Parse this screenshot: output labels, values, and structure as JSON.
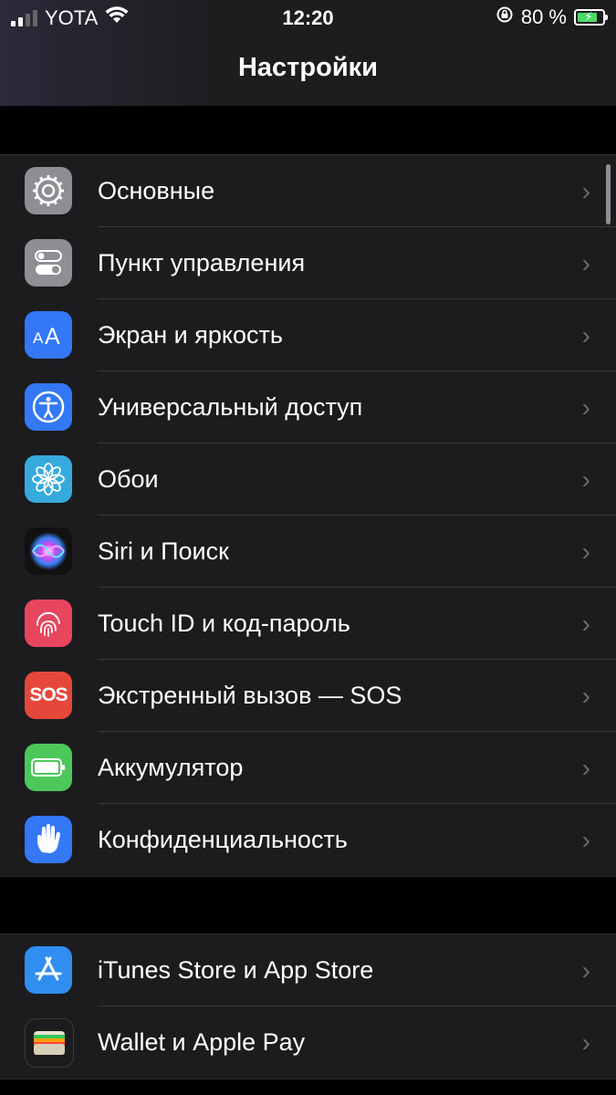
{
  "status_bar": {
    "carrier": "YOTA",
    "time": "12:20",
    "battery_percent": "80 %",
    "battery_level": 0.8
  },
  "nav": {
    "title": "Настройки"
  },
  "groups": [
    {
      "items": [
        {
          "label": "Основные",
          "icon": "gear-icon",
          "color": "#8e8e93"
        },
        {
          "label": "Пункт управления",
          "icon": "toggles-icon",
          "color": "#8e8e93"
        },
        {
          "label": "Экран и яркость",
          "icon": "text-size-icon",
          "color": "#3478f6"
        },
        {
          "label": "Универсальный доступ",
          "icon": "accessibility-icon",
          "color": "#3478f6"
        },
        {
          "label": "Обои",
          "icon": "flower-icon",
          "color": "#36aadc"
        },
        {
          "label": "Siri и Поиск",
          "icon": "siri-icon",
          "color": "#111111"
        },
        {
          "label": "Touch ID и код-пароль",
          "icon": "fingerprint-icon",
          "color": "#e8455e"
        },
        {
          "label": "Экстренный вызов — SOS",
          "icon": "sos-icon",
          "color": "#e5483b",
          "icon_text": "SOS"
        },
        {
          "label": "Аккумулятор",
          "icon": "battery-icon",
          "color": "#4cc85a"
        },
        {
          "label": "Конфиденциальность",
          "icon": "hand-icon",
          "color": "#3478f6"
        }
      ]
    },
    {
      "items": [
        {
          "label": "iTunes Store и App Store",
          "icon": "app-store-icon",
          "color": "#2f8ef0"
        },
        {
          "label": "Wallet и Apple Pay",
          "icon": "wallet-icon",
          "color": "#1c1c1e"
        }
      ]
    }
  ],
  "chevron": "›"
}
